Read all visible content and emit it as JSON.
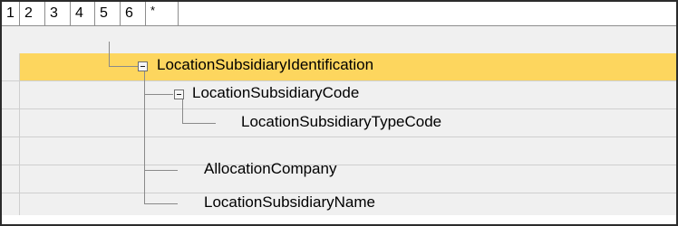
{
  "level_tabs": [
    "1",
    "2",
    "3",
    "4",
    "5",
    "6",
    "*"
  ],
  "tree": {
    "root": {
      "label": "LocationSubsidiaryIdentification",
      "expanded": true,
      "selected": true
    },
    "child_code": {
      "label": "LocationSubsidiaryCode",
      "expanded": true
    },
    "grandchild_type": {
      "label": "LocationSubsidiaryTypeCode"
    },
    "child_company": {
      "label": "AllocationCompany"
    },
    "child_name": {
      "label": "LocationSubsidiaryName"
    }
  },
  "colors": {
    "selection": "#fdd65e",
    "row_background": "#f0f0f0",
    "tree_line": "#8a8a8a"
  },
  "icons": {
    "expanded": "collapse-minus-icon"
  }
}
